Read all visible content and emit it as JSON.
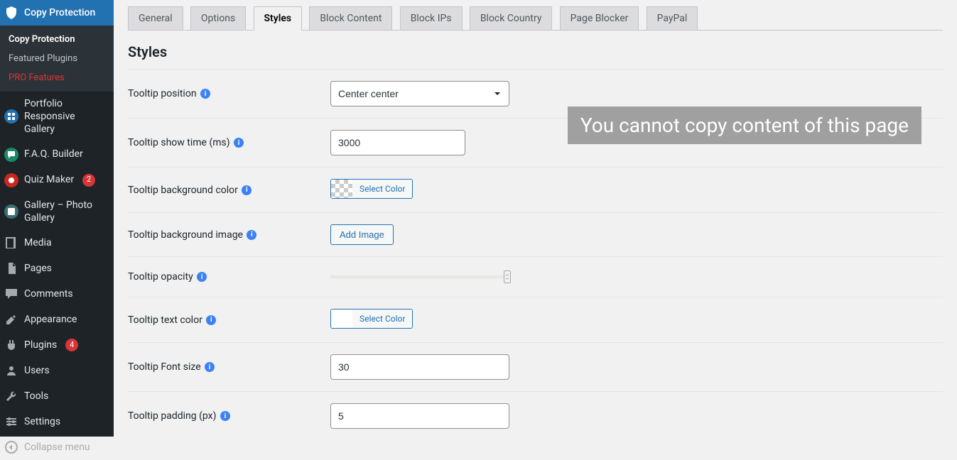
{
  "sidebar": {
    "current_plugin": "Copy Protection",
    "submenu": [
      {
        "label": "Copy Protection",
        "active": true
      },
      {
        "label": "Featured Plugins",
        "active": false
      },
      {
        "label": "PRO Features",
        "active": false,
        "pro": true
      }
    ],
    "items": [
      {
        "label": "Portfolio Responsive Gallery",
        "icon": "grid",
        "iconkind": "blue"
      },
      {
        "label": "F.A.Q. Builder",
        "icon": "chat",
        "iconkind": "green"
      },
      {
        "label": "Quiz Maker",
        "icon": "q",
        "iconkind": "red",
        "badge": "2"
      },
      {
        "label": "Gallery – Photo Gallery",
        "icon": "image",
        "iconkind": "teal"
      },
      {
        "label": "Media",
        "icon": "media"
      },
      {
        "label": "Pages",
        "icon": "pages"
      },
      {
        "label": "Comments",
        "icon": "comments"
      },
      {
        "spacer": true
      },
      {
        "label": "Appearance",
        "icon": "appearance"
      },
      {
        "label": "Plugins",
        "icon": "plugins",
        "badge": "4"
      },
      {
        "label": "Users",
        "icon": "users"
      },
      {
        "label": "Tools",
        "icon": "tools"
      },
      {
        "label": "Settings",
        "icon": "settings"
      }
    ],
    "collapse_label": "Collapse menu"
  },
  "tabs": [
    {
      "label": "General"
    },
    {
      "label": "Options"
    },
    {
      "label": "Styles",
      "active": true
    },
    {
      "label": "Block Content"
    },
    {
      "label": "Block IPs"
    },
    {
      "label": "Block Country"
    },
    {
      "label": "Page Blocker"
    },
    {
      "label": "PayPal"
    }
  ],
  "section_title": "Styles",
  "form": {
    "tooltip_position": {
      "label": "Tooltip position",
      "value": "Center center"
    },
    "tooltip_show_time": {
      "label": "Tooltip show time (ms)",
      "value": "3000"
    },
    "tooltip_bg_color": {
      "label": "Tooltip background color",
      "button": "Select Color"
    },
    "tooltip_bg_image": {
      "label": "Tooltip background image",
      "button": "Add Image"
    },
    "tooltip_opacity": {
      "label": "Tooltip opacity"
    },
    "tooltip_text_color": {
      "label": "Tooltip text color",
      "button": "Select Color"
    },
    "tooltip_font_size": {
      "label": "Tooltip Font size",
      "value": "30"
    },
    "tooltip_padding": {
      "label": "Tooltip padding (px)",
      "value": "5"
    }
  },
  "tooltip_preview_text": "You cannot copy content of this page"
}
